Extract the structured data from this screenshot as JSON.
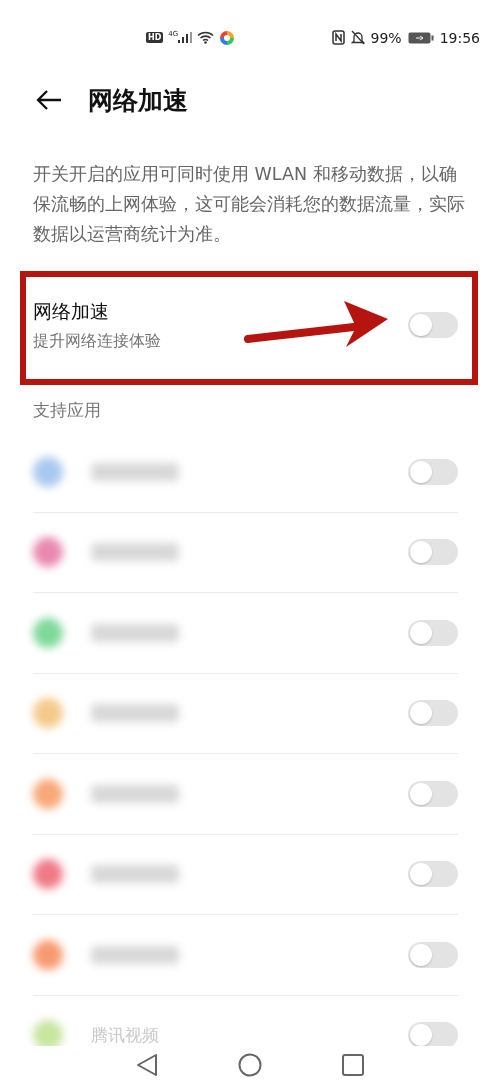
{
  "status_bar": {
    "hd": "HD",
    "network": "4G",
    "battery": "99%",
    "time": "19:56"
  },
  "header": {
    "title": "网络加速"
  },
  "description": "开关开启的应用可同时使用 WLAN 和移动数据，以确保流畅的上网体验，这可能会消耗您的数据流量，实际数据以运营商统计为准。",
  "main_setting": {
    "title": "网络加速",
    "subtitle": "提升网络连接体验",
    "on": false
  },
  "section_title": "支持应用",
  "apps": [
    {
      "color": "#a9c8f0",
      "on": false
    },
    {
      "color": "#e88ab0",
      "on": false
    },
    {
      "color": "#7fd99a",
      "on": false
    },
    {
      "color": "#f5c98a",
      "on": false
    },
    {
      "color": "#f8a878",
      "on": false
    },
    {
      "color": "#f07a88",
      "on": false
    },
    {
      "color": "#f89a70",
      "on": false
    },
    {
      "color": "#c8e6a0",
      "on": false,
      "name": "腾讯视频"
    }
  ]
}
